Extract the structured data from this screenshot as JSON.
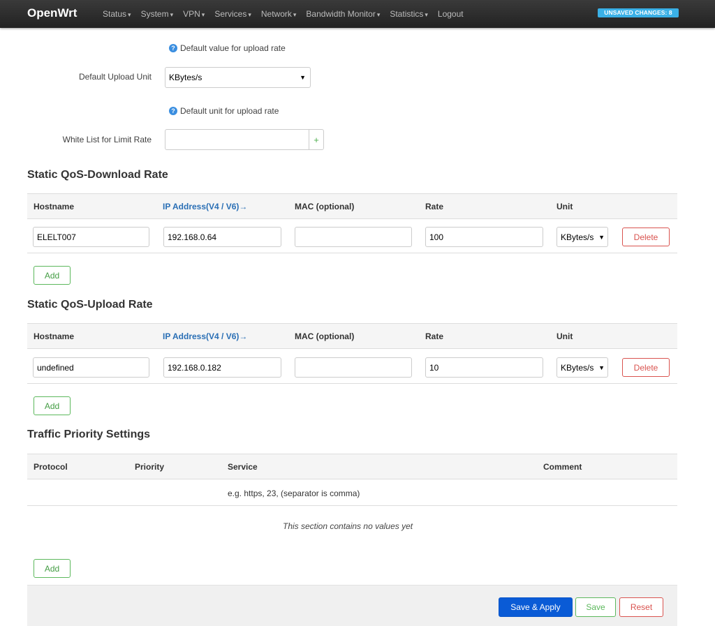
{
  "navbar": {
    "brand": "OpenWrt",
    "items": [
      {
        "label": "Status",
        "caret": "▾"
      },
      {
        "label": "System",
        "caret": "▾"
      },
      {
        "label": "VPN",
        "caret": "▾"
      },
      {
        "label": "Services",
        "caret": "▾"
      },
      {
        "label": "Network",
        "caret": "▾"
      },
      {
        "label": "Bandwidth Monitor",
        "caret": "▾"
      },
      {
        "label": "Statistics",
        "caret": "▾"
      },
      {
        "label": "Logout",
        "caret": ""
      }
    ],
    "badge": "UNSAVED CHANGES: 8"
  },
  "form": {
    "upload_rate_hint": "Default value for upload rate",
    "upload_unit_label": "Default Upload Unit",
    "upload_unit_value": "KBytes/s",
    "upload_unit_hint": "Default unit for upload rate",
    "whitelist_label": "White List for Limit Rate",
    "whitelist_value": "",
    "hint_icon": "?",
    "plus": "+",
    "select_arrow": "▼"
  },
  "download": {
    "title": "Static QoS-Download Rate",
    "headers": {
      "hostname": "Hostname",
      "ip": "IP Address(V4 / V6)→",
      "mac": "MAC (optional)",
      "rate": "Rate",
      "unit": "Unit"
    },
    "row": {
      "hostname": "ELELT007",
      "ip": "192.168.0.64",
      "mac": "",
      "rate": "100",
      "unit": "KBytes/s",
      "delete": "Delete"
    },
    "add": "Add"
  },
  "upload": {
    "title": "Static QoS-Upload Rate",
    "headers": {
      "hostname": "Hostname",
      "ip": "IP Address(V4 / V6)→",
      "mac": "MAC (optional)",
      "rate": "Rate",
      "unit": "Unit"
    },
    "row": {
      "hostname": "undefined",
      "ip": "192.168.0.182",
      "mac": "",
      "rate": "10",
      "unit": "KBytes/s",
      "delete": "Delete"
    },
    "add": "Add"
  },
  "priority": {
    "title": "Traffic Priority Settings",
    "headers": {
      "protocol": "Protocol",
      "priority": "Priority",
      "service": "Service",
      "comment": "Comment"
    },
    "service_hint": "e.g. https, 23, (separator is comma)",
    "empty": "This section contains no values yet",
    "add": "Add"
  },
  "footer": {
    "save_apply": "Save & Apply",
    "save": "Save",
    "reset": "Reset"
  },
  "colors": {
    "navbar": "#222222",
    "badge": "#3ab0e6",
    "primary": "#0a5bd6",
    "add_green": "#5cb85c",
    "delete_red": "#d9534f",
    "link_blue": "#2a6fb5"
  }
}
